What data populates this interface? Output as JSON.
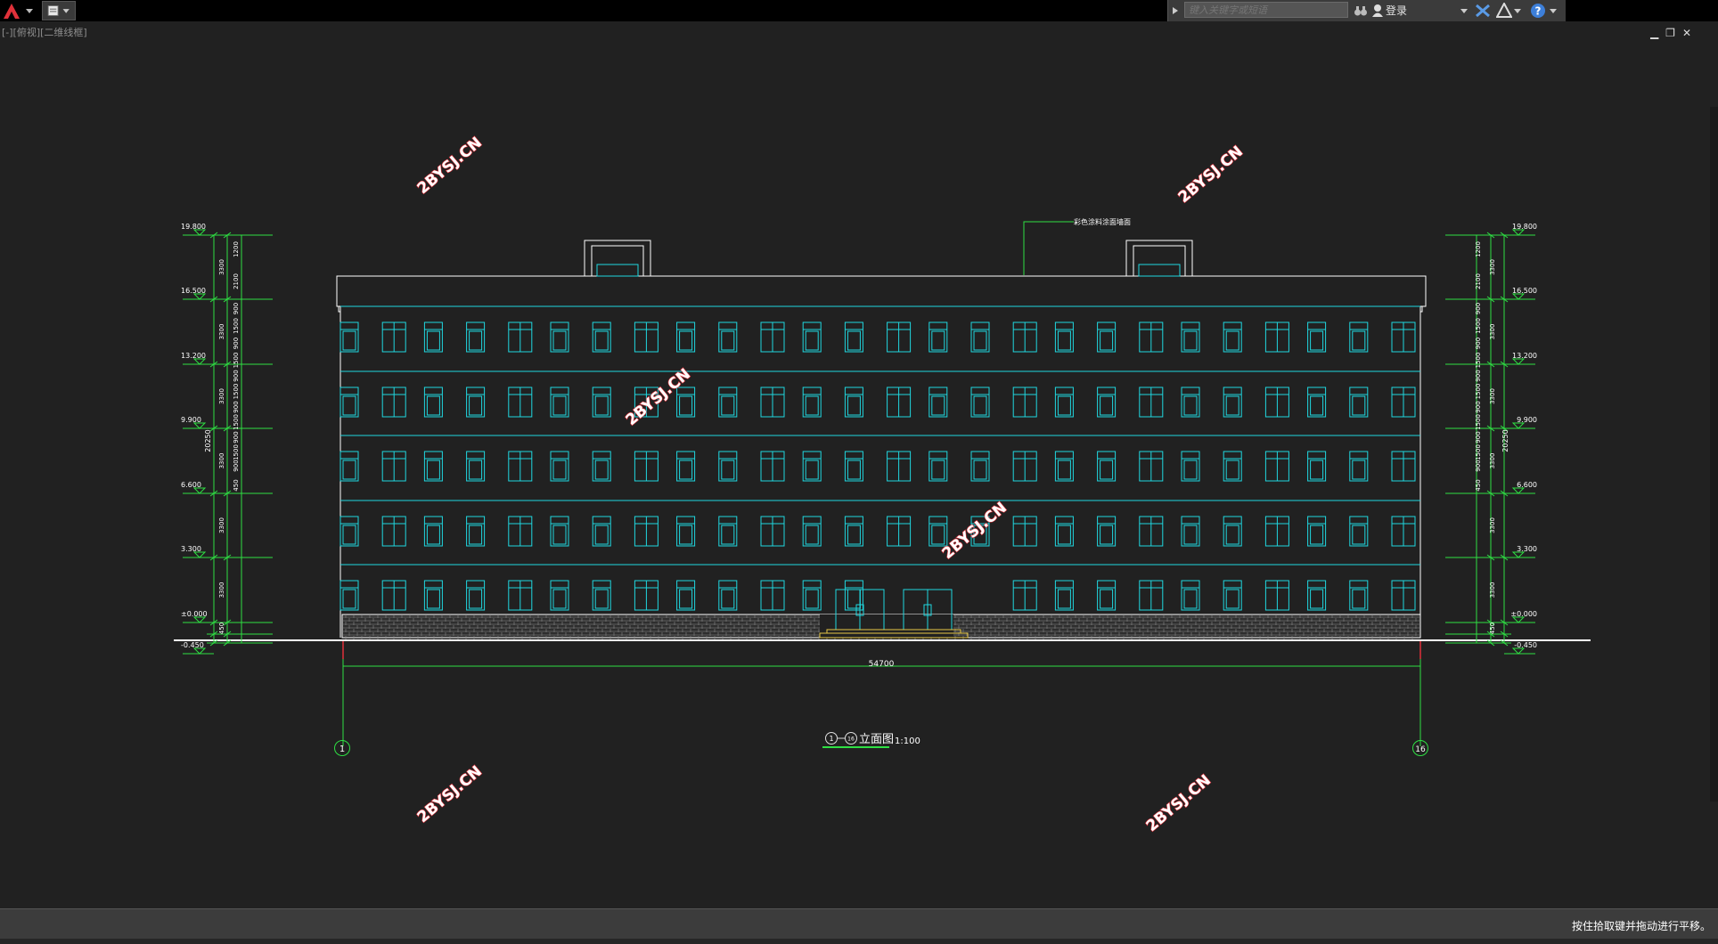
{
  "app": {
    "accent": "#e0313a",
    "background": "#212121"
  },
  "search": {
    "placeholder": "键入关键字或短语"
  },
  "account": {
    "login_label": "登录"
  },
  "viewport": {
    "label": "[-][俯视][二维线框]"
  },
  "status": {
    "message": "按住拾取键并拖动进行平移。"
  },
  "watermarks": [
    "2BYSJ.CN",
    "2BYSJ.CN",
    "2BYSJ.CN",
    "2BYSJ.CN",
    "2BYSJ.CN",
    "2BYSJ.CN"
  ],
  "drawing": {
    "leader_note": "彩色涂料涂面墙面",
    "title": "立面图",
    "scale": "1:100",
    "axis_start": "1",
    "axis_end": "16",
    "total_width": "54700",
    "total_height": "20250",
    "elevations": [
      "19.800",
      "16.500",
      "13.200",
      "9.900",
      "6.600",
      "3.300",
      "±0.000",
      "-0.450"
    ],
    "storey_dims": [
      "3300",
      "3300",
      "3300",
      "3300",
      "3300",
      "3300",
      "450"
    ],
    "detail_dims": [
      "1200",
      "2100",
      "900",
      "1500",
      "900",
      "1500",
      "900",
      "1500",
      "900",
      "1500",
      "900",
      "1500",
      "900",
      "450"
    ],
    "window_columns": 26,
    "floors": 5
  }
}
